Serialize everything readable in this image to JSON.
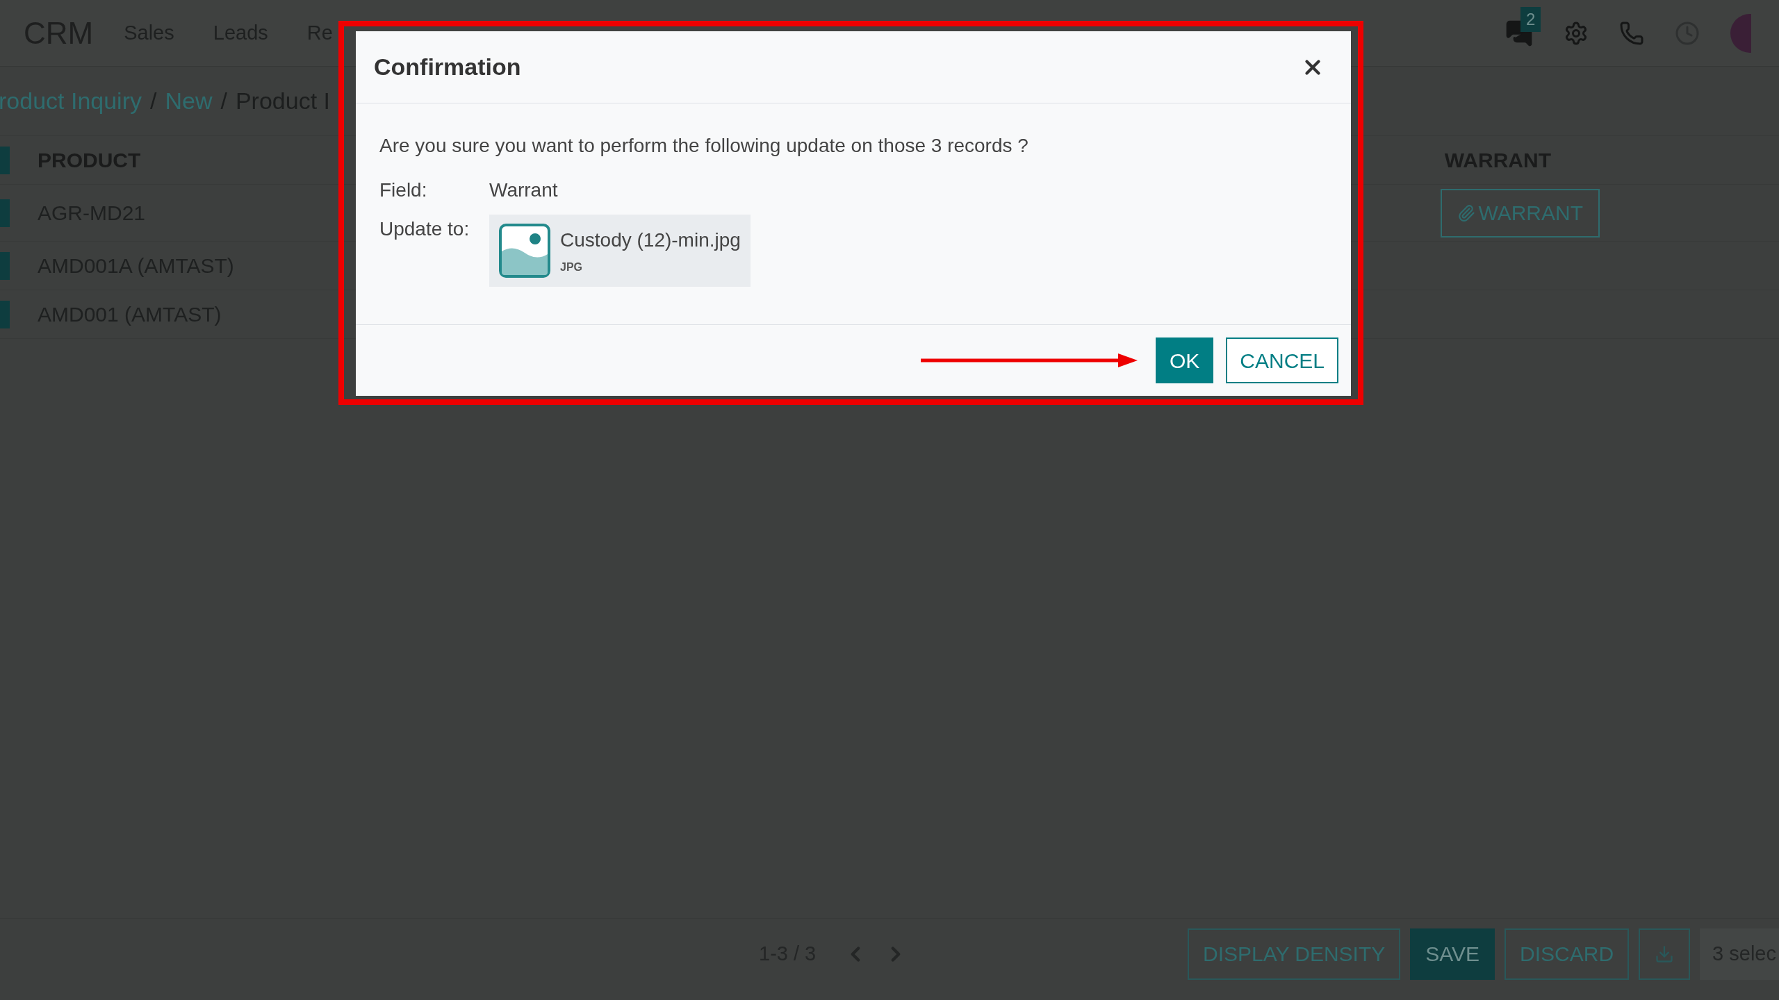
{
  "navbar": {
    "app_name": "CRM",
    "menu": [
      "Sales",
      "Leads",
      "Re"
    ],
    "notification_count": "2"
  },
  "breadcrumb": [
    {
      "label": "roduct Inquiry",
      "kind": "link"
    },
    {
      "label": "New",
      "kind": "link",
      "separator": "/"
    },
    {
      "label": "Product I",
      "kind": "current",
      "separator": "/"
    }
  ],
  "table": {
    "columns": [
      "PRODUCT",
      "WARRANT"
    ],
    "header_checked": true,
    "rows": [
      {
        "product": "AGR-MD21",
        "selected": true,
        "warrant_button": "WARRANT"
      },
      {
        "product": "AMD001A (AMTAST)",
        "selected": true
      },
      {
        "product": "AMD001 (AMTAST)",
        "selected": true
      }
    ]
  },
  "footer": {
    "pager": "1-3 / 3",
    "buttons": [
      {
        "label": "DISPLAY DENSITY",
        "kind": "outline"
      },
      {
        "label": "SAVE",
        "kind": "primary"
      },
      {
        "label": "DISCARD",
        "kind": "outline"
      }
    ],
    "selection": "3 selec"
  },
  "dialog": {
    "title": "Confirmation",
    "message": "Are you sure you want to perform the following update on those 3 records ?",
    "fields": [
      {
        "label": "Field:",
        "value": "Warrant",
        "kind": "text"
      },
      {
        "label": "Update to:",
        "kind": "file",
        "file_name": "Custody (12)-min.jpg",
        "file_type": "JPG"
      }
    ],
    "buttons": [
      {
        "label": "OK",
        "kind": "primary"
      },
      {
        "label": "CANCEL",
        "kind": "outline"
      }
    ]
  }
}
